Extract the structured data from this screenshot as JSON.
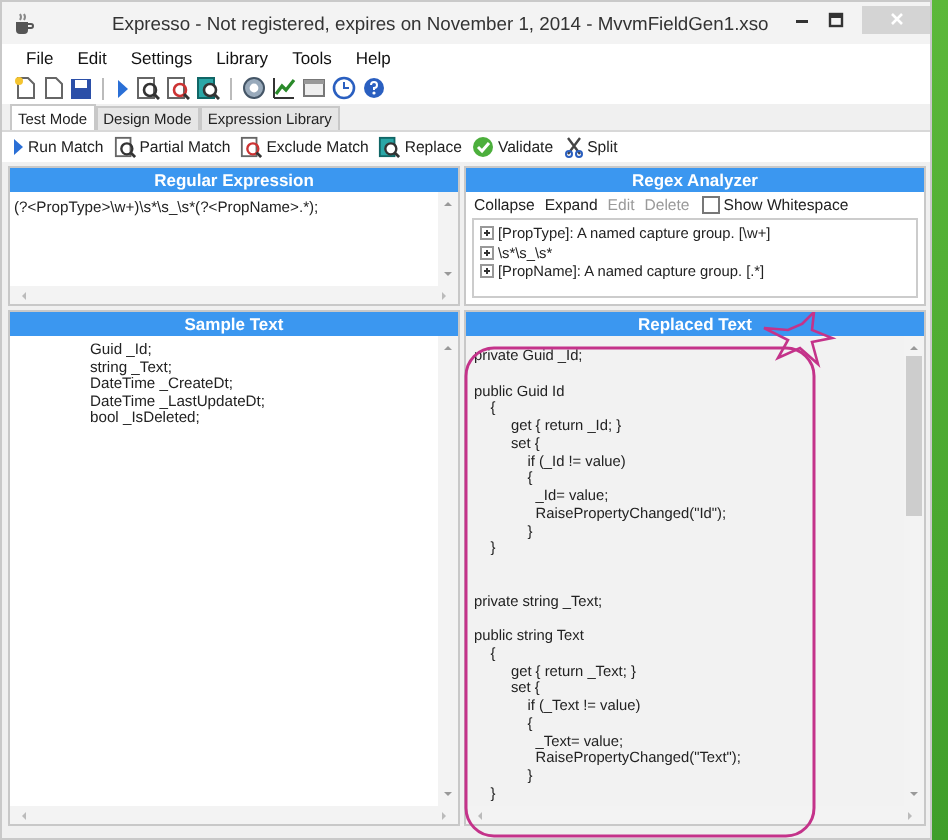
{
  "window": {
    "title": "Expresso - Not registered, expires on November 1, 2014 - MvvmFieldGen1.xso"
  },
  "menu": [
    "File",
    "Edit",
    "Settings",
    "Library",
    "Tools",
    "Help"
  ],
  "tabs": [
    {
      "label": "Test Mode",
      "selected": true
    },
    {
      "label": "Design Mode",
      "selected": false
    },
    {
      "label": "Expression Library",
      "selected": false
    }
  ],
  "actions": [
    {
      "label": "Run Match",
      "kind": "run"
    },
    {
      "label": "Partial Match",
      "kind": "partial"
    },
    {
      "label": "Exclude Match",
      "kind": "exclude"
    },
    {
      "label": "Replace",
      "kind": "replace"
    },
    {
      "label": "Validate",
      "kind": "validate"
    },
    {
      "label": "Split",
      "kind": "split"
    }
  ],
  "regex_panel": {
    "title": "Regular Expression",
    "value": "(?<PropType>\\w+)\\s*\\s_\\s*(?<PropName>.*);"
  },
  "analyzer": {
    "title": "Regex Analyzer",
    "tools": [
      {
        "label": "Collapse",
        "disabled": false
      },
      {
        "label": "Expand",
        "disabled": false
      },
      {
        "label": "Edit",
        "disabled": true
      },
      {
        "label": "Delete",
        "disabled": true
      }
    ],
    "show_whitespace": {
      "label": "Show Whitespace",
      "checked": false
    },
    "nodes": [
      {
        "label": "[PropType]: A named capture group. [\\w+]",
        "expanded": false
      },
      {
        "label": "\\s*\\s_\\s*",
        "expanded": false
      },
      {
        "label": "[PropName]: A named capture group. [.*]",
        "expanded": false
      }
    ]
  },
  "sample": {
    "title": "Sample Text",
    "text": "Guid _Id;\nstring _Text;\nDateTime _CreateDt;\nDateTime _LastUpdateDt;\nbool _IsDeleted;"
  },
  "replaced": {
    "title": "Replaced Text",
    "text": "private Guid _Id;\n\npublic Guid Id\n    {\n         get { return _Id; }\n         set {\n             if (_Id != value)\n             {\n               _Id= value;\n               RaisePropertyChanged(\"Id\");\n             }\n    }\n\n\nprivate string _Text;\n\npublic string Text\n    {\n         get { return _Text; }\n         set {\n             if (_Text != value)\n             {\n               _Text= value;\n               RaisePropertyChanged(\"Text\");\n             }\n    }"
  }
}
